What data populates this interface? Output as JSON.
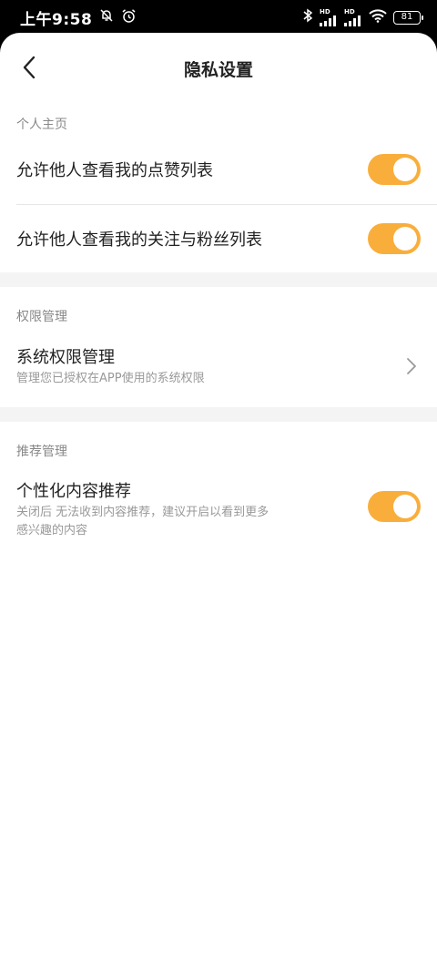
{
  "status_bar": {
    "time": "上午9:58",
    "battery": "81",
    "hd_label_1": "HD",
    "hd_label_2": "HD"
  },
  "header": {
    "title": "隐私设置"
  },
  "sections": [
    {
      "header": "个人主页",
      "items": [
        {
          "label": "允许他人查看我的点赞列表",
          "toggle": true
        },
        {
          "label": "允许他人查看我的关注与粉丝列表",
          "toggle": true
        }
      ]
    },
    {
      "header": "权限管理",
      "items": [
        {
          "label": "系统权限管理",
          "subtitle": "管理您已授权在APP使用的系统权限"
        }
      ]
    },
    {
      "header": "推荐管理",
      "items": [
        {
          "label": "个性化内容推荐",
          "subtitle_line1": "关闭后 无法收到内容推荐，建议开启以看到更多",
          "subtitle_line2": "感兴趣的内容",
          "toggle": true
        }
      ]
    }
  ],
  "colors": {
    "toggle_on": "#F9AE3C",
    "text_primary": "#222222",
    "text_secondary": "#888888"
  },
  "icons": [
    "back-arrow-icon",
    "chevron-right-icon",
    "mute-bell-icon",
    "alarm-icon",
    "bluetooth-icon",
    "signal-icon",
    "wifi-icon",
    "battery-icon"
  ]
}
